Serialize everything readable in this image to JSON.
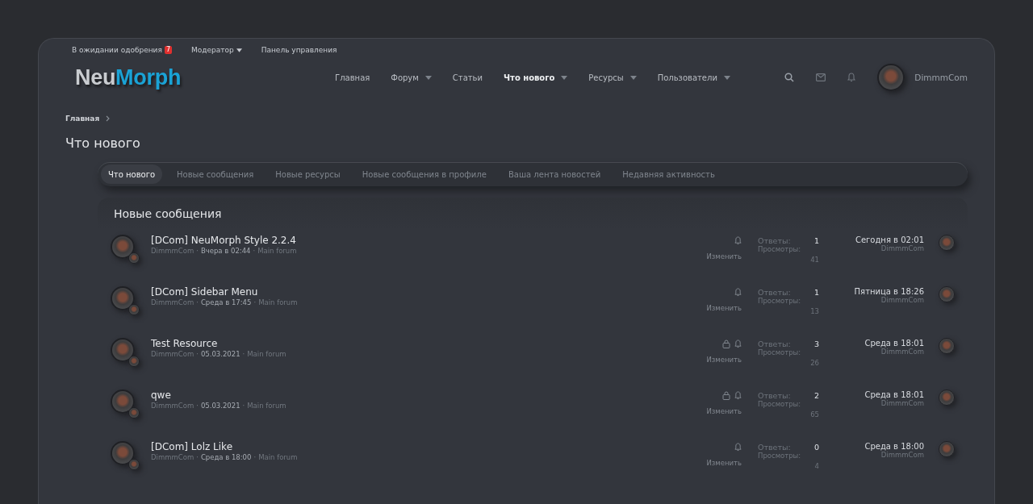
{
  "top_links": [
    {
      "label": "В ожидании одобрения",
      "badge": "7",
      "dropdown": false
    },
    {
      "label": "Модератор",
      "dropdown": true
    },
    {
      "label": "Панель управления",
      "dropdown": false
    }
  ],
  "logo": {
    "first": "Neu",
    "second": "Morph"
  },
  "nav": [
    {
      "label": "Главная",
      "selected": false,
      "dropdown": false
    },
    {
      "label": "Форум",
      "selected": false,
      "dropdown": true
    },
    {
      "label": "Статьи",
      "selected": false,
      "dropdown": false
    },
    {
      "label": "Что нового",
      "selected": true,
      "dropdown": true
    },
    {
      "label": "Ресурсы",
      "selected": false,
      "dropdown": true
    },
    {
      "label": "Пользователи",
      "selected": false,
      "dropdown": true
    }
  ],
  "user": {
    "name": "DimmmCom"
  },
  "breadcrumb": [
    "Главная"
  ],
  "page_title": "Что нового",
  "tabs": [
    {
      "label": "Что нового",
      "selected": true
    },
    {
      "label": "Новые сообщения",
      "selected": false
    },
    {
      "label": "Новые ресурсы",
      "selected": false
    },
    {
      "label": "Новые сообщения в профиле",
      "selected": false
    },
    {
      "label": "Ваша лента новостей",
      "selected": false
    },
    {
      "label": "Недавняя активность",
      "selected": false
    }
  ],
  "block": {
    "title": "Новые сообщения",
    "rows": [
      {
        "title": "[DCom] NeuMorph Style 2.2.4",
        "meta": [
          {
            "kind": "author",
            "text": "DimmmCom"
          },
          {
            "kind": "sep",
            "text": "·"
          },
          {
            "kind": "date",
            "text": "Вчера в 02:44"
          },
          {
            "kind": "sep",
            "text": "·"
          },
          {
            "kind": "forum",
            "text": "Main forum"
          }
        ],
        "locked": false,
        "edit_label": "Изменить",
        "replies_label": "Ответы:",
        "replies": "1",
        "views_label": "Просмотры:",
        "views": "41",
        "last_date": "Сегодня в 02:01",
        "last_author": "DimmmCom"
      },
      {
        "title": "[DCom] Sidebar Menu",
        "meta": [
          {
            "kind": "author",
            "text": "DimmmCom"
          },
          {
            "kind": "sep",
            "text": "·"
          },
          {
            "kind": "date",
            "text": "Среда в 17:45"
          },
          {
            "kind": "sep",
            "text": "·"
          },
          {
            "kind": "forum",
            "text": "Main forum"
          }
        ],
        "locked": false,
        "edit_label": "Изменить",
        "replies_label": "Ответы:",
        "replies": "1",
        "views_label": "Просмотры:",
        "views": "13",
        "last_date": "Пятница в 18:26",
        "last_author": "DimmmCom"
      },
      {
        "title": "Test Resource",
        "meta": [
          {
            "kind": "author",
            "text": "DimmmCom"
          },
          {
            "kind": "sep",
            "text": "·"
          },
          {
            "kind": "date",
            "text": "05.03.2021"
          },
          {
            "kind": "sep",
            "text": "·"
          },
          {
            "kind": "forum",
            "text": "Main forum"
          }
        ],
        "locked": true,
        "edit_label": "Изменить",
        "replies_label": "Ответы:",
        "replies": "3",
        "views_label": "Просмотры:",
        "views": "26",
        "last_date": "Среда в 18:01",
        "last_author": "DimmmCom"
      },
      {
        "title": "qwe",
        "meta": [
          {
            "kind": "author",
            "text": "DimmmCom"
          },
          {
            "kind": "sep",
            "text": "·"
          },
          {
            "kind": "date",
            "text": "05.03.2021"
          },
          {
            "kind": "sep",
            "text": "·"
          },
          {
            "kind": "forum",
            "text": "Main forum"
          }
        ],
        "locked": true,
        "edit_label": "Изменить",
        "replies_label": "Ответы:",
        "replies": "2",
        "views_label": "Просмотры:",
        "views": "65",
        "last_date": "Среда в 18:01",
        "last_author": "DimmmCom"
      },
      {
        "title": "[DCom] Lolz Like",
        "meta": [
          {
            "kind": "author",
            "text": "DimmmCom"
          },
          {
            "kind": "sep",
            "text": "·"
          },
          {
            "kind": "date",
            "text": "Среда в 18:00"
          },
          {
            "kind": "sep",
            "text": "·"
          },
          {
            "kind": "forum",
            "text": "Main forum"
          }
        ],
        "locked": false,
        "edit_label": "Изменить",
        "replies_label": "Ответы:",
        "replies": "0",
        "views_label": "Просмотры:",
        "views": "4",
        "last_date": "Среда в 18:00",
        "last_author": "DimmmCom"
      }
    ]
  }
}
